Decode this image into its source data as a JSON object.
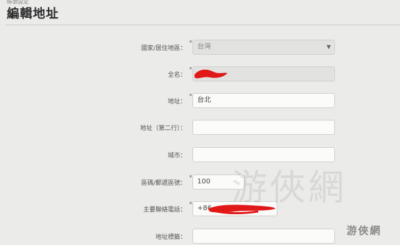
{
  "breadcrumb": "帳號設定",
  "title": "編輯地址",
  "form": {
    "country": {
      "label": "國家/居住地區：",
      "value": "台灣"
    },
    "name": {
      "label": "全名：",
      "value": ""
    },
    "address1": {
      "label": "地址：",
      "value": "台北"
    },
    "address2": {
      "label": "地址（第二行）：",
      "value": ""
    },
    "city": {
      "label": "城市：",
      "value": ""
    },
    "postal": {
      "label": "區碼/郵遞區號：",
      "value": "100"
    },
    "phone": {
      "label": "主要聯絡電話：",
      "value": "+86"
    },
    "state": {
      "label": "地址標籤："
    }
  },
  "required_mark": "*",
  "colors": {
    "redaction": "#e01818"
  },
  "watermark": {
    "large": "游俠網",
    "corner": "游俠網"
  }
}
